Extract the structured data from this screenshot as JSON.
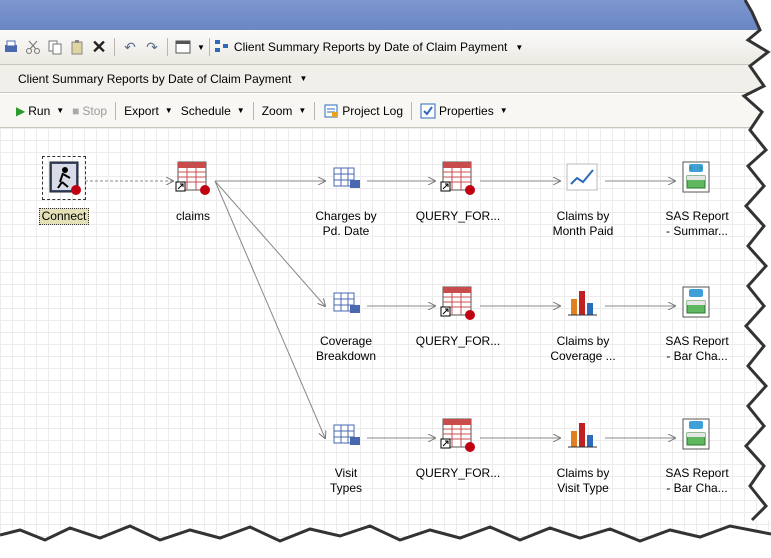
{
  "toolbar": {
    "workflow_name": "Client Summary Reports by Date of Claim Payment"
  },
  "breadcrumb": {
    "label": "Client Summary Reports by Date of Claim Payment"
  },
  "actions": {
    "run": "Run",
    "stop": "Stop",
    "export": "Export",
    "schedule": "Schedule",
    "zoom": "Zoom",
    "project_log": "Project Log",
    "properties": "Properties"
  },
  "nodes": {
    "connect": "Connect",
    "claims": "claims",
    "charges": "Charges by\nPd. Date",
    "query1": "QUERY_FOR...",
    "claims_month": "Claims by\nMonth Paid",
    "report1": "SAS Report\n- Summar...",
    "coverage": "Coverage\nBreakdown",
    "query2": "QUERY_FOR...",
    "claims_coverage": "Claims by\nCoverage ...",
    "report2": "SAS Report\n- Bar Cha...",
    "visit": "Visit\nTypes",
    "query3": "QUERY_FOR...",
    "claims_visit": "Claims by\nVisit Type",
    "report3": "SAS Report\n- Bar Cha..."
  }
}
